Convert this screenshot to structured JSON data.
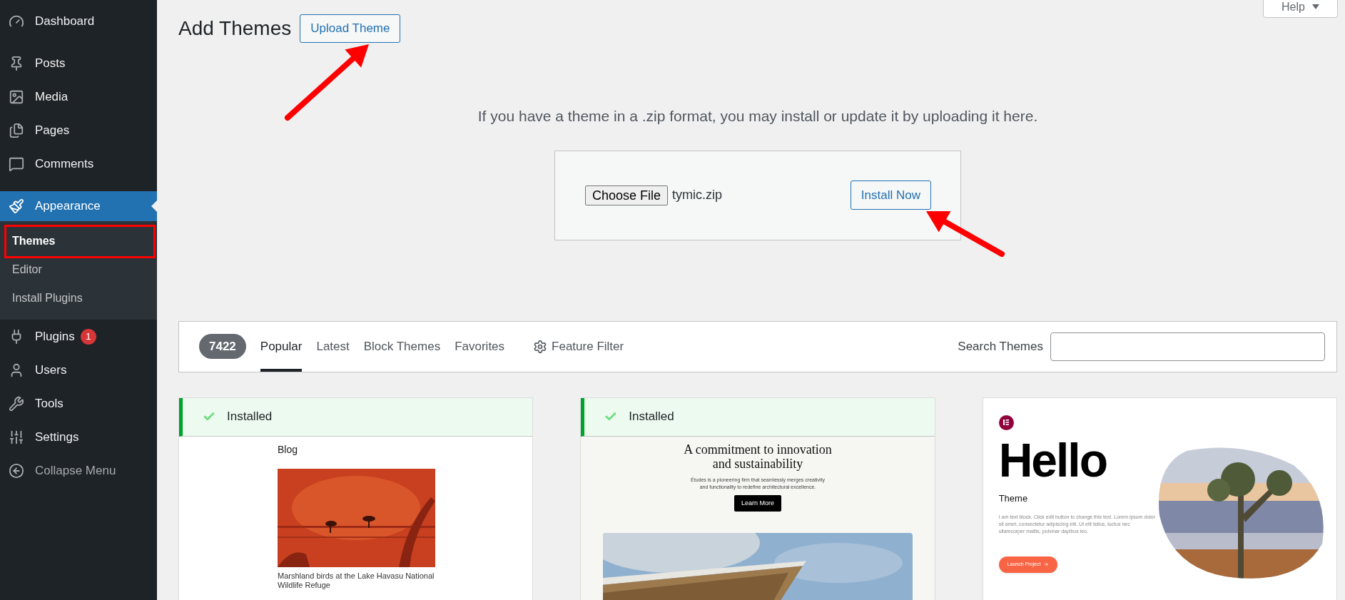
{
  "sidebar": {
    "groups": [
      [
        {
          "label": "Dashboard",
          "selected": false
        }
      ],
      [
        {
          "label": "Posts",
          "selected": false
        },
        {
          "label": "Media",
          "selected": false
        },
        {
          "label": "Pages",
          "selected": false
        },
        {
          "label": "Comments",
          "selected": false
        }
      ],
      [
        {
          "label": "Appearance",
          "selected": true,
          "children": [
            {
              "label": "Themes",
              "selected": true,
              "highlighted": true
            },
            {
              "label": "Editor",
              "selected": false,
              "highlighted": false
            },
            {
              "label": "Install Plugins",
              "selected": false,
              "highlighted": false
            }
          ]
        },
        {
          "label": "Plugins",
          "selected": false,
          "badge": "1"
        },
        {
          "label": "Users",
          "selected": false
        },
        {
          "label": "Tools",
          "selected": false
        },
        {
          "label": "Settings",
          "selected": false
        }
      ]
    ],
    "collapse": "Collapse Menu"
  },
  "help": "Help",
  "title": "Add Themes",
  "upload_button": "Upload Theme",
  "upload_note": "If you have a theme in a .zip format, you may install or update it by uploading it here.",
  "upload_form": {
    "choose_button": "Choose File",
    "file_name": "tymic.zip",
    "install_button": "Install Now"
  },
  "filter_bar": {
    "count": "7422",
    "tabs": [
      {
        "label": "Popular",
        "selected": true
      },
      {
        "label": "Latest",
        "selected": false
      },
      {
        "label": "Block Themes",
        "selected": false
      },
      {
        "label": "Favorites",
        "selected": false
      }
    ],
    "feature_filter": "Feature Filter",
    "search_label": "Search Themes"
  },
  "themes": [
    {
      "installed": true,
      "status": "Installed",
      "preview": {
        "kind": "blog",
        "heading": "Blog",
        "caption": "Marshland birds at the Lake Havasu National Wildlife Refuge"
      }
    },
    {
      "installed": true,
      "status": "Installed",
      "preview": {
        "kind": "business",
        "heading": "A commitment to innovation and sustainability",
        "text": "Études is a pioneering firm that seamlessly merges creativity and functionality to redefine architectural excellence.",
        "button": "Learn More"
      }
    },
    {
      "installed": false,
      "preview": {
        "kind": "hello",
        "heading": "Hello",
        "subheading": "Theme",
        "text": "I am text block. Click edit button to change this text. Lorem ipsum dolor sit amet, consectetur adipiscing elit. Ut elit tellus, luctus nec ullamcorper mattis, pulvinar dapibus leo.",
        "button": "Launch Project"
      }
    }
  ]
}
